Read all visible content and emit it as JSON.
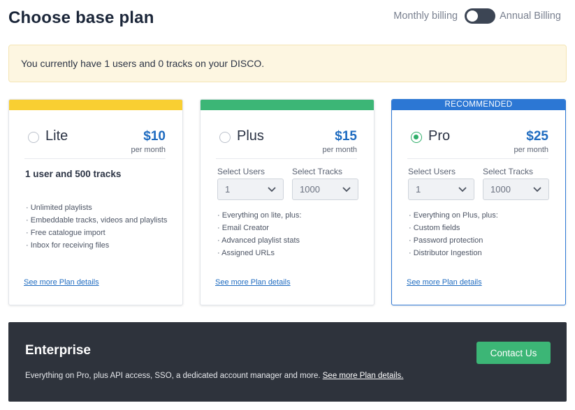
{
  "header": {
    "title": "Choose base plan",
    "billing_monthly": "Monthly billing",
    "billing_annual": "Annual Billing",
    "billing_selected": "Monthly billing"
  },
  "notice": {
    "text": "You currently have 1 users and 0 tracks on your DISCO."
  },
  "plans": {
    "lite": {
      "name": "Lite",
      "price": "$10",
      "price_period": "per month",
      "band_color": "#f9cf32",
      "selected": false,
      "headline": "1 user and 500 tracks",
      "features": [
        "Unlimited playlists",
        "Embeddable tracks, videos and playlists",
        "Free catalogue import",
        "Inbox for receiving files"
      ],
      "details_link": "See more Plan details"
    },
    "plus": {
      "name": "Plus",
      "price": "$15",
      "price_period": "per month",
      "band_color": "#3cb676",
      "selected": false,
      "users_label": "Select Users",
      "users_value": "1",
      "tracks_label": "Select Tracks",
      "tracks_value": "1000",
      "features": [
        "Everything on lite, plus:",
        "Email Creator",
        "Advanced playlist stats",
        "Assigned URLs"
      ],
      "details_link": "See more Plan details"
    },
    "pro": {
      "name": "Pro",
      "price": "$25",
      "price_period": "per month",
      "band_color": "#2c77d4",
      "badge": "RECOMMENDED",
      "selected": true,
      "users_label": "Select Users",
      "users_value": "1",
      "tracks_label": "Select Tracks",
      "tracks_value": "1000",
      "features": [
        "Everything on Plus, plus:",
        "Custom fields",
        "Password protection",
        "Distributor Ingestion"
      ],
      "details_link": "See more Plan details"
    }
  },
  "enterprise": {
    "title": "Enterprise",
    "description": "Everything on Pro, plus API access, SSO, a dedicated account manager and more.",
    "details_link": "See more Plan details.",
    "button_label": "Contact Us"
  },
  "colors": {
    "accent_blue": "#1e6bc0",
    "accent_green": "#3cb676",
    "dark_panel": "#2e333c",
    "notice_bg": "#fdf6e1"
  },
  "icons": {
    "select_chevron": "chevron-down-icon",
    "radio": "radio-icon"
  }
}
